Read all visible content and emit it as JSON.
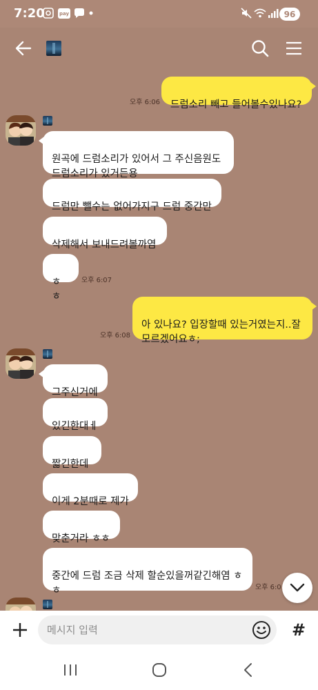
{
  "status_bar": {
    "time": "7:20",
    "pay_label": "pay",
    "battery": "96"
  },
  "header": {
    "back_icon": "arrow-left-icon",
    "search_icon": "search-icon",
    "menu_icon": "hamburger-menu-icon"
  },
  "messages": [
    {
      "dir": "out",
      "text": "드럼소리 빼고 들어볼수있나요?",
      "time": "오후 6:06"
    },
    {
      "dir": "in",
      "text": "원곡에 드럼소리가 있어서 그 주신음원도\n드럼소리가 있거든용"
    },
    {
      "dir": "in",
      "text": "드럼만 뺄수는 없어가지구 드럼 중간만"
    },
    {
      "dir": "in",
      "text": "삭제해서 보내드려볼까염"
    },
    {
      "dir": "in",
      "text": "ㅎㅎ",
      "time": "오후 6:07"
    },
    {
      "dir": "out",
      "text": "아 있나요? 입장할때 있는거였는지..잘\n모르겠어요ㅎ;",
      "time": "오후 6:08"
    },
    {
      "dir": "in",
      "text": "그주신거에"
    },
    {
      "dir": "in",
      "text": "있긴한대ㅔ"
    },
    {
      "dir": "in",
      "text": "짧긴한데"
    },
    {
      "dir": "in",
      "text": "이게 2분때로 제가"
    },
    {
      "dir": "in",
      "text": "맞춘거라 ㅎㅎ"
    },
    {
      "dir": "in",
      "text": "중간에 드럼 조금 삭제 할순있을꺼같긴해염 ㅎ\nㅎ",
      "time": "오후 6:0"
    }
  ],
  "input": {
    "placeholder": "메시지 입력",
    "add_icon": "plus-icon",
    "emoji_icon": "emoji-icon",
    "hash_icon": "hashtag-icon",
    "hash_label": "#"
  },
  "nav": {
    "recents_icon": "recent-apps-icon",
    "home_icon": "home-icon",
    "back_icon": "back-icon"
  },
  "colors": {
    "chat_bg": "#a98574",
    "status_bg": "#ad8877",
    "out_bubble": "#fde844",
    "in_bubble": "#ffffff"
  }
}
